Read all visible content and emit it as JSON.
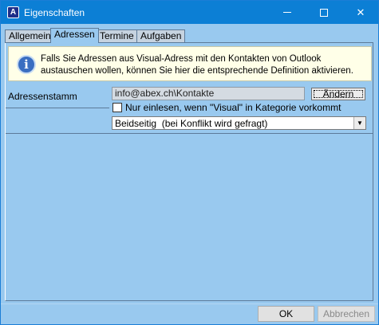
{
  "window": {
    "title": "Eigenschaften",
    "app_icon_letter": "A",
    "controls": {
      "minimize": "minimize-icon",
      "maximize": "maximize-icon",
      "close": "close-icon",
      "close_glyph": "✕"
    }
  },
  "tabs": [
    {
      "label": "Allgemein",
      "active": false
    },
    {
      "label": "Adressen",
      "active": true
    },
    {
      "label": "Termine",
      "active": false
    },
    {
      "label": "Aufgaben",
      "active": false
    }
  ],
  "info": {
    "icon": "info-icon",
    "icon_glyph": "i",
    "text": "Falls Sie Adressen aus Visual-Adress mit den Kontakten von Outlook austauschen wollen, können Sie hier die entsprechende Definition aktivieren."
  },
  "adressen": {
    "label": "Adressenstamm",
    "path_value": "info@abex.ch\\Kontakte",
    "change_button": "Ändern",
    "checkbox_label": "Nur einlesen, wenn \"Visual\" in Kategorie vorkommt",
    "checkbox_checked": false,
    "sync_selected": "Beidseitig  (bei Konflikt wird gefragt)",
    "dropdown_glyph": "▼"
  },
  "footer": {
    "ok_label": "OK",
    "cancel_label": "Abbrechen",
    "cancel_disabled": true
  },
  "colors": {
    "titlebar": "#0c7fd5",
    "panel": "#99c9ef",
    "infobox": "#ffffe8"
  }
}
